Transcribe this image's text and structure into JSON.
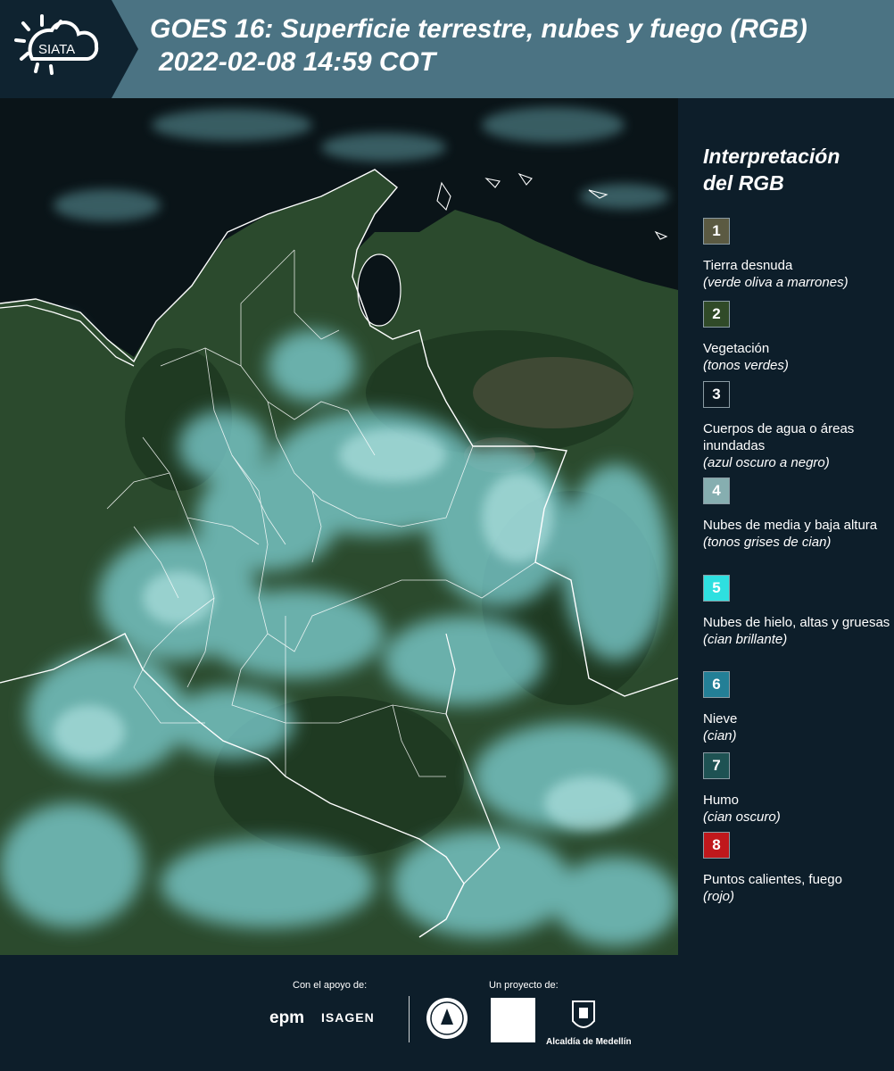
{
  "header": {
    "logo_text": "SIATA",
    "title_line1": "GOES 16: Superficie terrestre, nubes y fuego (RGB)",
    "title_line2": "2022-02-08 14:59 COT",
    "background_color": "#4b7383"
  },
  "legend": {
    "title_line1": "Interpretación",
    "title_line2": "del RGB",
    "items": [
      {
        "number": "1",
        "label": "Tierra desnuda",
        "sub": "(verde oliva a marrones)",
        "color": "#5b5a42"
      },
      {
        "number": "2",
        "label": "Vegetación",
        "sub": "(tonos verdes)",
        "color": "#304a28"
      },
      {
        "number": "3",
        "label": "Cuerpos de agua o áreas inundadas",
        "sub": "(azul oscuro a negro)",
        "color": "#0c1a24"
      },
      {
        "number": "4",
        "label": "Nubes de media y baja altura",
        "sub": "(tonos grises de cian)",
        "color": "#86aeb0"
      },
      {
        "number": "5",
        "label": "Nubes de hielo, altas y gruesas",
        "sub": "(cian brillante)",
        "color": "#2ee0e0"
      },
      {
        "number": "6",
        "label": "Nieve",
        "sub": "(cian)",
        "color": "#237f96"
      },
      {
        "number": "7",
        "label": "Humo",
        "sub": "(cian oscuro)",
        "color": "#1e5253"
      },
      {
        "number": "8",
        "label": "Puntos calientes, fuego",
        "sub": "(rojo)",
        "color": "#c0181c"
      }
    ]
  },
  "footer": {
    "support_label": "Con el apoyo de:",
    "project_label": "Un proyecto de:",
    "sponsor_1": "epm",
    "sponsor_2": "ISAGEN",
    "partner_3": "Alcaldía de Medellín"
  },
  "map": {
    "ocean_color": "#0a1418",
    "land_color": "#2c4a2c",
    "cloud_color": "#7fd6d8",
    "border_color": "#ffffff"
  }
}
